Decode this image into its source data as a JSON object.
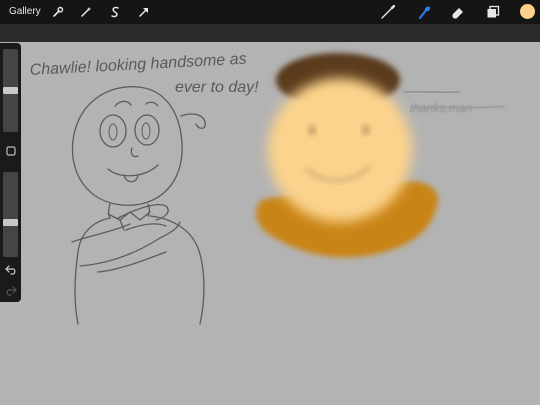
{
  "toolbar": {
    "gallery_label": "Gallery",
    "actions": [
      "wrench-icon",
      "magic-wand-icon",
      "selection-icon",
      "transform-arrow-icon"
    ],
    "tools": [
      "brush-icon",
      "smudge-icon",
      "eraser-icon",
      "layers-icon"
    ],
    "active_tool": "smudge-icon",
    "current_color": "#fcd38c"
  },
  "sidebar": {
    "brush_size_level": 0.5,
    "opacity_level": 0.4,
    "modify_button": "square-modify-icon",
    "undo": "undo-icon",
    "redo": "redo-icon"
  },
  "canvas": {
    "caption_line1": "Chawlie! looking handsome as",
    "caption_line2": "ever to day!",
    "scribble_text": "thanks,man",
    "colors": {
      "background": "#b3b3b3",
      "skin": "#fcd38c",
      "hair": "#5a3a1e",
      "shirt": "#c98418",
      "line": "#5a5a5a"
    }
  }
}
